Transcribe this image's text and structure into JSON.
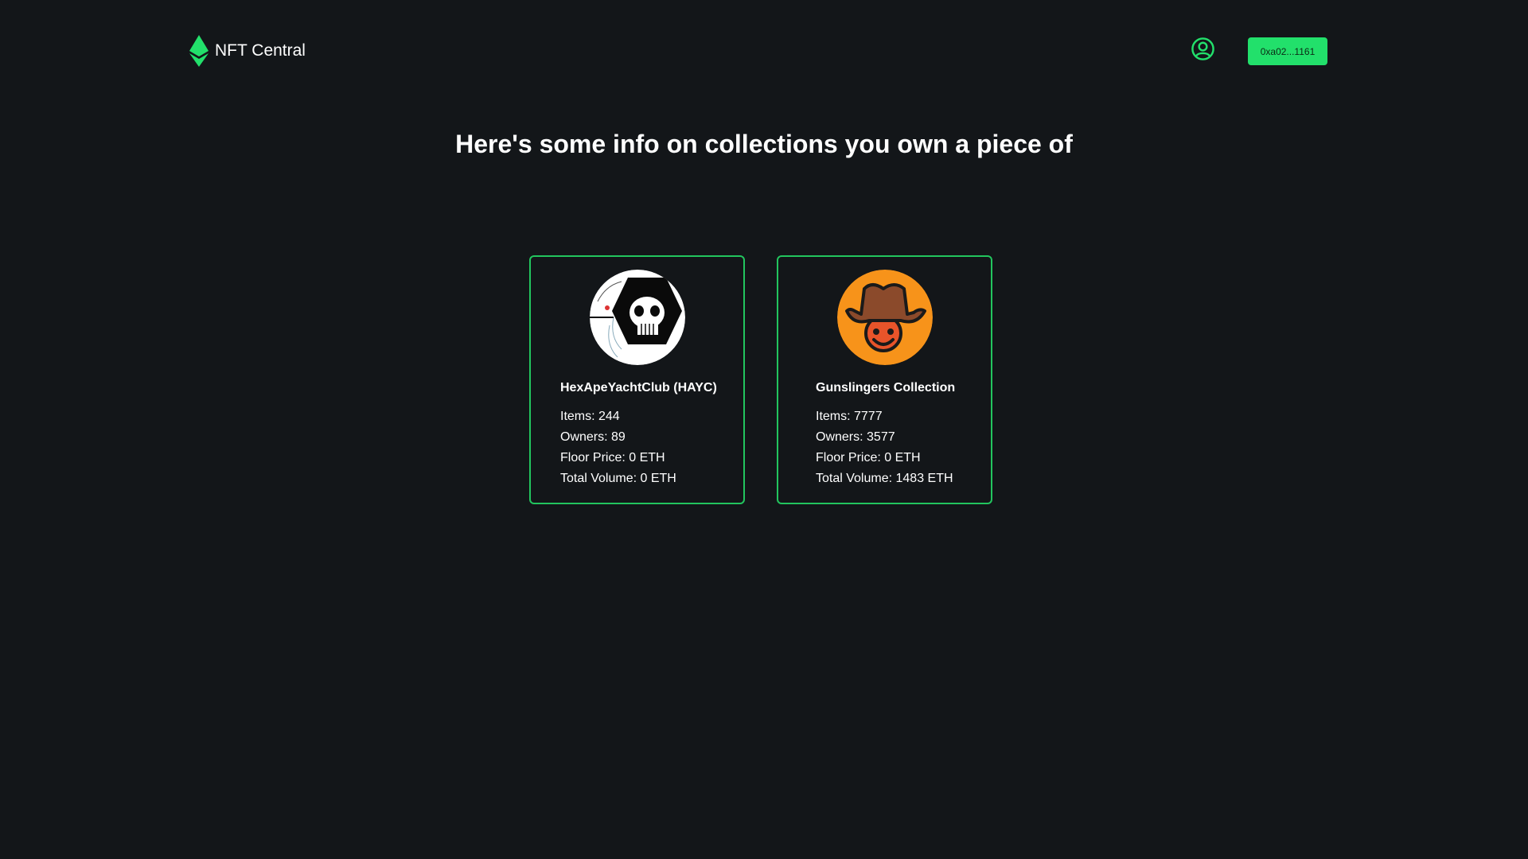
{
  "header": {
    "brand": "NFT Central",
    "wallet_label": "0xa02...1161",
    "accent_color": "#22e06b"
  },
  "headline": "Here's some info on collections you own a piece of",
  "collections": [
    {
      "name": "HexApeYachtClub (HAYC)",
      "items": "Items: 244",
      "owners": "Owners: 89",
      "floor": "Floor Price: 0 ETH",
      "volume": "Total Volume: 0 ETH",
      "avatar_icon": "hex-ape-skull-icon"
    },
    {
      "name": "Gunslingers Collection",
      "items": "Items: 7777",
      "owners": "Owners: 3577",
      "floor": "Floor Price: 0 ETH",
      "volume": "Total Volume: 1483 ETH",
      "avatar_icon": "cowboy-hat-icon"
    }
  ]
}
